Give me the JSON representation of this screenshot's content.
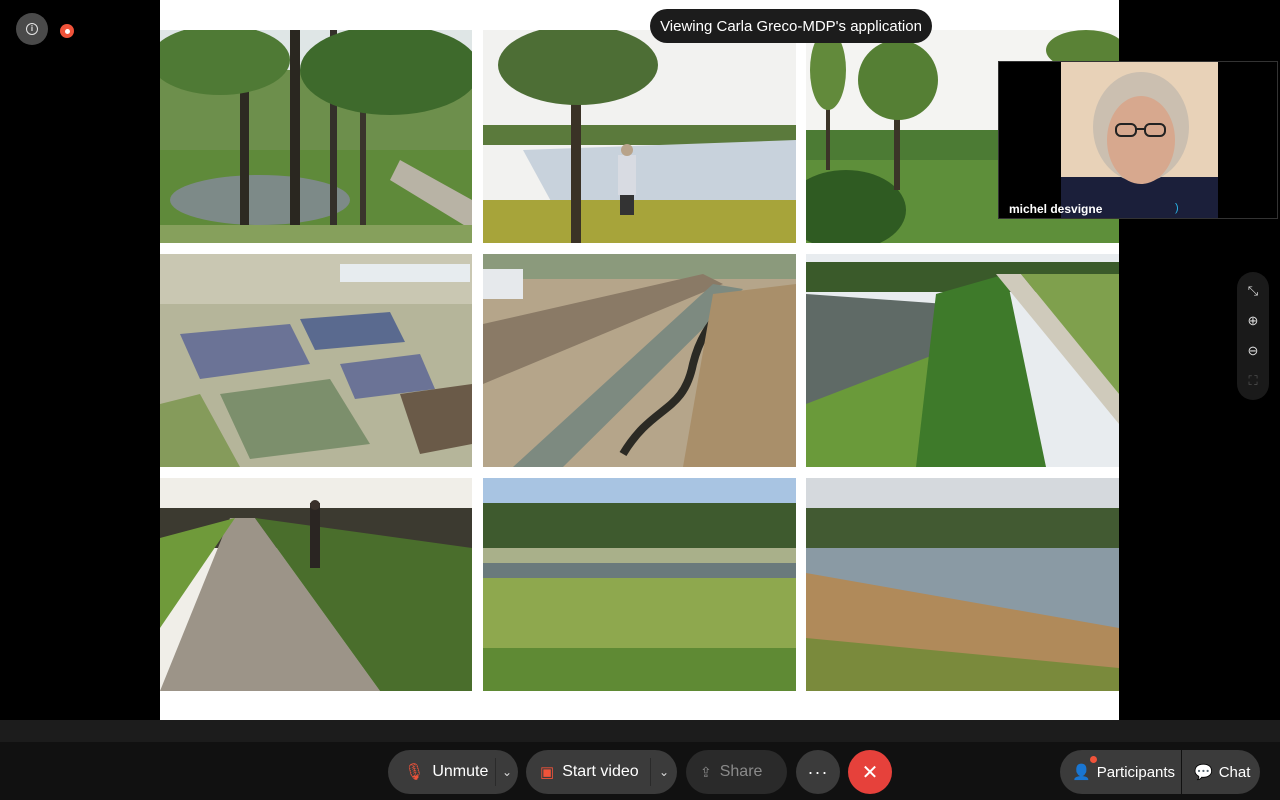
{
  "banner": {
    "text": "Viewing Carla Greco-MDP's application"
  },
  "self_view": {
    "name": "michel desvigne",
    "audio_indicator": ")"
  },
  "top_left": {
    "info_icon": "info-icon",
    "recording_icon": "recording-dot-icon"
  },
  "zoom_controls": {
    "icons": [
      "collapse-icon",
      "zoom-in-icon",
      "zoom-out-icon",
      "fit-screen-icon"
    ]
  },
  "toolbar": {
    "unmute_label": "Unmute",
    "start_video_label": "Start video",
    "share_label": "Share",
    "more_label": "···",
    "leave_label": "✕",
    "participants_label": "Participants",
    "chat_label": "Chat"
  },
  "colors": {
    "leave": "#e6413b",
    "recording": "#f0533a",
    "toolbar_bg": "#111111",
    "pill_bg": "#3b3b3b"
  }
}
